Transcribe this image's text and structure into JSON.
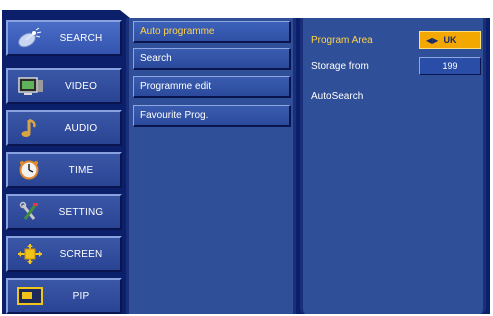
{
  "categories": [
    {
      "label": "SEARCH",
      "icon": "satellite-dish-icon",
      "active": true
    },
    {
      "label": "VIDEO",
      "icon": "tv-icon",
      "active": false
    },
    {
      "label": "AUDIO",
      "icon": "music-note-icon",
      "active": false
    },
    {
      "label": "TIME",
      "icon": "clock-icon",
      "active": false
    },
    {
      "label": "SETTING",
      "icon": "tools-icon",
      "active": false
    },
    {
      "label": "SCREEN",
      "icon": "screen-adjust-icon",
      "active": false
    },
    {
      "label": "PIP",
      "icon": "pip-icon",
      "active": false
    }
  ],
  "submenu": [
    {
      "label": "Auto programme",
      "active": true
    },
    {
      "label": "Search",
      "active": false
    },
    {
      "label": "Programme edit",
      "active": false
    },
    {
      "label": "Favourite Prog.",
      "active": false
    }
  ],
  "settings": {
    "program_area": {
      "label": "Program Area",
      "value": "UK"
    },
    "storage_from": {
      "label": "Storage from",
      "value": "199"
    },
    "auto_search": {
      "label": "AutoSearch"
    }
  },
  "colors": {
    "frame": "#0c1f6a",
    "panel": "#2f4f98",
    "highlight_text": "#ffd34a",
    "selected_value_bg": "#f2a800"
  }
}
